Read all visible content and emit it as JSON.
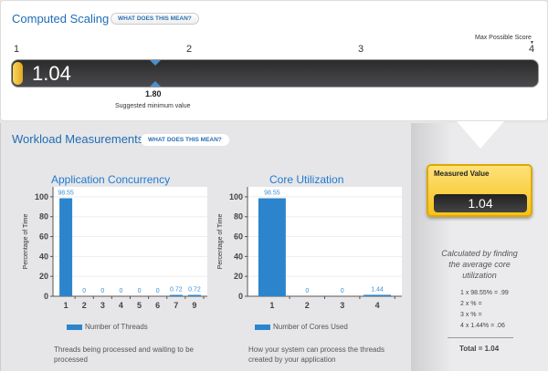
{
  "computed": {
    "title": "Computed Scaling",
    "help": "WHAT DOES THIS MEAN?",
    "ticks": [
      "1",
      "2",
      "3",
      "4"
    ],
    "max_label": "Max Possible Score",
    "value": "1.04",
    "value_num": 1.04,
    "suggested": "1.80",
    "suggested_num": 1.8,
    "suggested_label": "Suggested minimum value"
  },
  "workload": {
    "title": "Workload Measurements",
    "help": "WHAT DOES THIS MEAN?"
  },
  "chart_data": [
    {
      "type": "bar",
      "title": "Application Concurrency",
      "ylabel": "Percentage of Time",
      "categories": [
        "1",
        "2",
        "3",
        "4",
        "5",
        "6",
        "7",
        "9"
      ],
      "values": [
        98.55,
        0,
        0,
        0,
        0,
        0,
        0.72,
        0.72
      ],
      "labels": [
        "98.55",
        "0",
        "0",
        "0",
        "0",
        "0",
        "0.72",
        "0.72"
      ],
      "ylim": [
        0,
        110
      ],
      "yticks": [
        "0",
        "20",
        "40",
        "60",
        "80",
        "100"
      ],
      "legend": "Number of Threads",
      "description": "Threads being processed and waiting to be processed"
    },
    {
      "type": "bar",
      "title": "Core Utilization",
      "ylabel": "Percentage of Time",
      "categories": [
        "1",
        "2",
        "3",
        "4"
      ],
      "values": [
        98.55,
        0,
        0,
        1.44
      ],
      "labels": [
        "98.55",
        "0",
        "0",
        "1.44"
      ],
      "ylim": [
        0,
        110
      ],
      "yticks": [
        "0",
        "20",
        "40",
        "60",
        "80",
        "100"
      ],
      "legend": "Number of Cores Used",
      "description": "How your system can process the threads created by your application"
    }
  ],
  "measured": {
    "label": "Measured Value",
    "value": "1.04",
    "calc_desc": "Calculated by finding the average core utilization",
    "lines": [
      "1 x 98.55% = .99",
      "2 x % =",
      "3 x % =",
      "4 x 1.44% = .06"
    ],
    "total": "Total = 1.04"
  },
  "colors": {
    "accent": "#1f6cb5",
    "bar": "#2c85cc",
    "gauge_fill": "#f6c21a"
  }
}
